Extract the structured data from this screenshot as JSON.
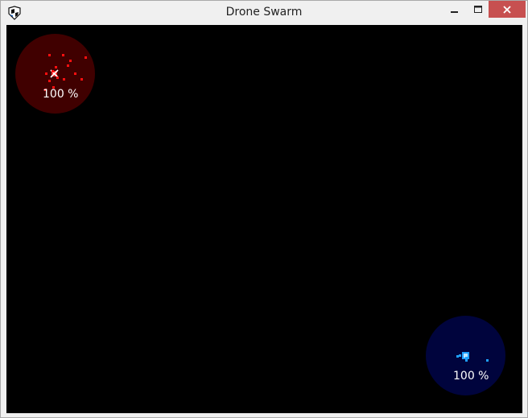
{
  "window": {
    "title": "Drone Swarm"
  },
  "icons": {
    "app": "app-icon",
    "minimize": "minimize-icon",
    "maximize": "maximize-icon",
    "close": "close-icon"
  },
  "colors": {
    "red_team_base": "#400000",
    "red_team_drone": "#ff1010",
    "blue_team_base": "#00043d",
    "blue_team_drone": "#1ea0ff",
    "arena_background": "#000000",
    "close_button": "#c75050"
  },
  "teams": {
    "red": {
      "health": "100 %"
    },
    "blue": {
      "health": "100 %"
    }
  }
}
